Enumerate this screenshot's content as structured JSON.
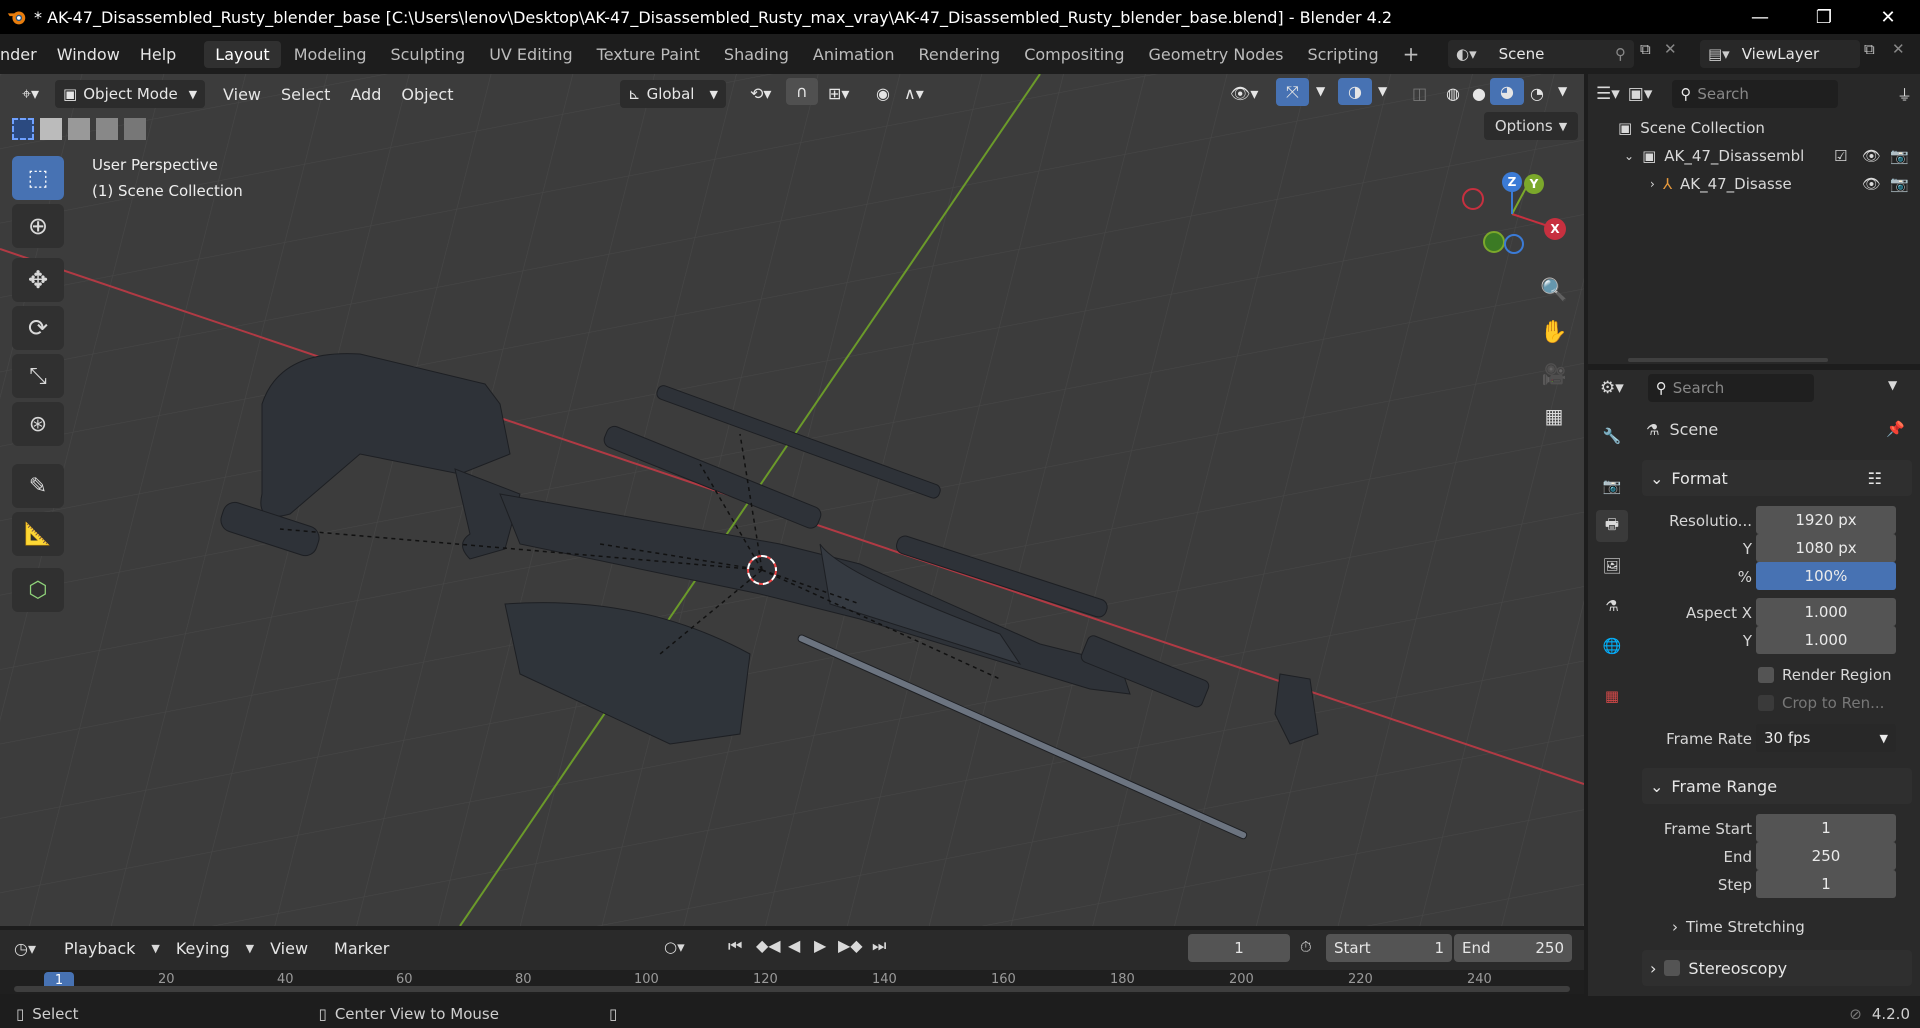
{
  "window": {
    "title": "* AK-47_Disassembled_Rusty_blender_base [C:\\Users\\lenov\\Desktop\\AK-47_Disassembled_Rusty_max_vray\\AK-47_Disassembled_Rusty_blender_base.blend] - Blender 4.2",
    "minimize": "—",
    "maximize": "❐",
    "close": "✕"
  },
  "menubar": {
    "items": [
      "nder",
      "Window",
      "Help"
    ],
    "workspaces": [
      "Layout",
      "Modeling",
      "Sculpting",
      "UV Editing",
      "Texture Paint",
      "Shading",
      "Animation",
      "Rendering",
      "Compositing",
      "Geometry Nodes",
      "Scripting"
    ],
    "add_workspace": "+",
    "scene": "Scene",
    "view_layer": "ViewLayer"
  },
  "viewport": {
    "mode": "Object Mode",
    "menus": [
      "View",
      "Select",
      "Add",
      "Object"
    ],
    "transform_orientation": "Global",
    "options": "Options",
    "overlay_title": "User Perspective",
    "overlay_collection": "(1) Scene Collection",
    "gizmo": {
      "z": "Z",
      "y": "Y",
      "x": "X"
    }
  },
  "outliner": {
    "search_placeholder": "Search",
    "root": "Scene Collection",
    "items": [
      {
        "label": "AK_47_Disassembl"
      },
      {
        "label": "AK_47_Disasse"
      }
    ]
  },
  "properties": {
    "search_placeholder": "Search",
    "context": "Scene",
    "format": {
      "header": "Format",
      "resolution_x_label": "Resolutio...",
      "resolution_x": "1920 px",
      "y_label": "Y",
      "resolution_y": "1080 px",
      "percent_label": "%",
      "percent": "100%",
      "aspect_x_label": "Aspect X",
      "aspect_x": "1.000",
      "aspect_y_label": "Y",
      "aspect_y": "1.000",
      "render_region": "Render Region",
      "crop": "Crop to Ren...",
      "frame_rate_label": "Frame Rate",
      "frame_rate": "30 fps"
    },
    "frame_range": {
      "header": "Frame Range",
      "start_label": "Frame Start",
      "start": "1",
      "end_label": "End",
      "end": "250",
      "step_label": "Step",
      "step": "1",
      "time_stretching": "Time Stretching",
      "stereoscopy": "Stereoscopy"
    }
  },
  "timeline": {
    "menus": [
      "Playback",
      "Keying",
      "View",
      "Marker"
    ],
    "current_frame": "1",
    "start_label": "Start",
    "start": "1",
    "end_label": "End",
    "end": "250",
    "ticks": [
      "20",
      "40",
      "60",
      "80",
      "100",
      "120",
      "140",
      "160",
      "180",
      "200",
      "220",
      "240"
    ],
    "playhead": "1"
  },
  "statusbar": {
    "select": "Select",
    "center_view": "Center View to Mouse",
    "version": "4.2.0"
  },
  "colors": {
    "accent": "#4772b3",
    "x_axis": "#c7303f",
    "y_axis": "#7ba82b",
    "z_axis": "#3b7bd6"
  }
}
